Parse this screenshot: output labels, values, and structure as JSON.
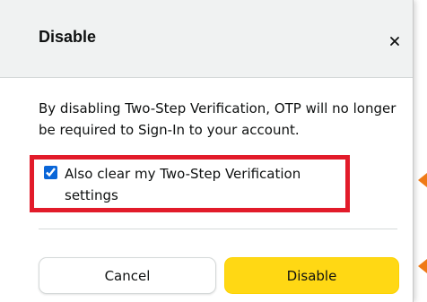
{
  "dialog": {
    "title": "Disable",
    "close_label": "×",
    "message": "By disabling Two-Step Verification, OTP will no longer be required to Sign-In to your account.",
    "checkbox": {
      "label": "Also clear my Two-Step Verification settings",
      "checked": true
    },
    "buttons": {
      "cancel": "Cancel",
      "disable": "Disable"
    }
  },
  "colors": {
    "header_bg": "#f0f2f2",
    "primary_button": "#ffd814",
    "highlight_border": "#e21b2a",
    "annotation_arrow": "#ef7a17",
    "checkbox_accent": "#0a66d8"
  },
  "icons": {
    "close": "close-icon",
    "annotation": "arrow-pointer-icon"
  }
}
